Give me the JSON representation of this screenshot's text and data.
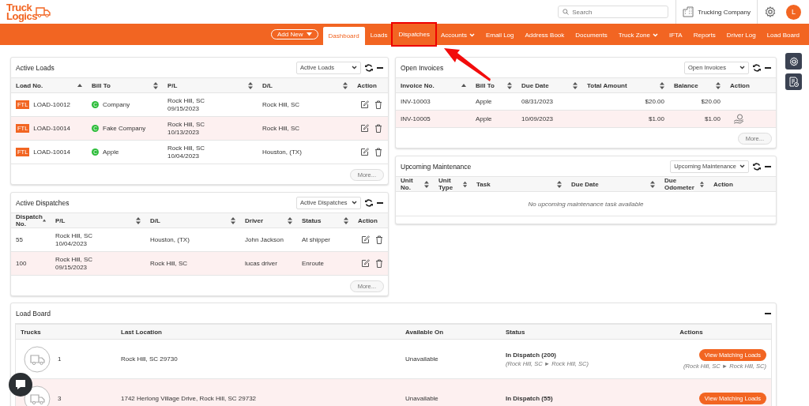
{
  "header": {
    "logo": {
      "line1": "Truck",
      "line2": "Logics"
    },
    "search": {
      "placeholder": "Search"
    },
    "company": "Trucking Company",
    "avatar": "L"
  },
  "nav": {
    "add_new": "Add New",
    "items": [
      {
        "label": "Dashboard",
        "selected": true,
        "dropdown": false,
        "highlighted": false
      },
      {
        "label": "Loads",
        "selected": false,
        "dropdown": false,
        "highlighted": false
      },
      {
        "label": "Dispatches",
        "selected": false,
        "dropdown": false,
        "highlighted": true
      },
      {
        "label": "Accounts",
        "selected": false,
        "dropdown": true,
        "highlighted": false
      },
      {
        "label": "Email Log",
        "selected": false,
        "dropdown": false,
        "highlighted": false
      },
      {
        "label": "Address Book",
        "selected": false,
        "dropdown": false,
        "highlighted": false
      },
      {
        "label": "Documents",
        "selected": false,
        "dropdown": false,
        "highlighted": false
      },
      {
        "label": "Truck Zone",
        "selected": false,
        "dropdown": true,
        "highlighted": false
      },
      {
        "label": "IFTA",
        "selected": false,
        "dropdown": false,
        "highlighted": false
      },
      {
        "label": "Reports",
        "selected": false,
        "dropdown": false,
        "highlighted": false
      },
      {
        "label": "Driver Log",
        "selected": false,
        "dropdown": false,
        "highlighted": false
      },
      {
        "label": "Load Board",
        "selected": false,
        "dropdown": false,
        "highlighted": false
      }
    ]
  },
  "active_loads": {
    "title": "Active Loads",
    "select": "Active Loads",
    "more": "More...",
    "columns": [
      {
        "label": "Load No.",
        "sortable": true,
        "sorted": true
      },
      {
        "label": "Bill To",
        "sortable": true,
        "sorted": false
      },
      {
        "label": "P/L",
        "sortable": true,
        "sorted": false
      },
      {
        "label": "D/L",
        "sortable": true,
        "sorted": false
      },
      {
        "label": "Action",
        "sortable": false
      }
    ],
    "rows": [
      {
        "tag": "FTL",
        "load_no": "LOAD-10012",
        "badge": "C",
        "bill_to": "Company",
        "pl": [
          "Rock Hill, SC",
          "09/15/2023"
        ],
        "dl": "Rock Hill, SC",
        "editable": true,
        "deletable": true
      },
      {
        "tag": "FTL",
        "load_no": "LOAD-10014",
        "badge": "C",
        "bill_to": "Fake Company",
        "pl": [
          "Rock Hill, SC",
          "10/13/2023"
        ],
        "dl": "Rock Hill, SC",
        "editable": true,
        "deletable": true
      },
      {
        "tag": "FTL",
        "load_no": "LOAD-10014",
        "badge": "C",
        "bill_to": "Apple",
        "pl": [
          "Rock Hill, SC",
          "10/04/2023"
        ],
        "dl": "Houston, (TX)",
        "editable": true,
        "deletable": true
      }
    ]
  },
  "active_dispatches": {
    "title": "Active Dispatches",
    "select": "Active Dispatches",
    "more": "More...",
    "columns": [
      {
        "label": "Dispatch No.",
        "sortable": true,
        "sorted": true
      },
      {
        "label": "P/L",
        "sortable": true,
        "sorted": false
      },
      {
        "label": "D/L",
        "sortable": true,
        "sorted": false
      },
      {
        "label": "Driver",
        "sortable": true,
        "sorted": false
      },
      {
        "label": "Status",
        "sortable": true,
        "sorted": false
      },
      {
        "label": "Action",
        "sortable": false
      }
    ],
    "rows": [
      {
        "cells": [
          "55",
          [
            "Rock Hill, SC",
            "10/04/2023"
          ],
          "Houston, (TX)",
          "John Jackson",
          "At shipper"
        ],
        "editable": true,
        "deletable": true
      },
      {
        "cells": [
          "100",
          [
            "Rock Hill, SC",
            "09/15/2023"
          ],
          "Rock Hill, SC",
          "lucas driver",
          "Enroute"
        ],
        "editable": true,
        "deletable": true
      }
    ]
  },
  "open_invoices": {
    "title": "Open Invoices",
    "select": "Open Invoices",
    "more": "More...",
    "columns": [
      {
        "label": "Invoice No.",
        "sortable": true,
        "sorted": true
      },
      {
        "label": "Bill To",
        "sortable": true,
        "sorted": false
      },
      {
        "label": "Due Date",
        "sortable": true,
        "sorted": false
      },
      {
        "label": "Total Amount",
        "sortable": true,
        "sorted": false
      },
      {
        "label": "Balance",
        "sortable": true,
        "sorted": false
      },
      {
        "label": "Action",
        "sortable": false
      }
    ],
    "rows": [
      {
        "cells": [
          "INV-10003",
          "Apple",
          "08/31/2023",
          "$20.00",
          "$20.00"
        ],
        "payable": false
      },
      {
        "cells": [
          "INV-10005",
          "Apple",
          "10/09/2023",
          "$1.00",
          "$1.00"
        ],
        "payable": true
      }
    ]
  },
  "upcoming_maintenance": {
    "title": "Upcoming Maintenance",
    "select": "Upcoming Maintenance",
    "columns": [
      {
        "label": "Unit No.",
        "sortable": true,
        "sorted": false
      },
      {
        "label": "Unit Type",
        "sortable": true,
        "sorted": false
      },
      {
        "label": "Task",
        "sortable": true,
        "sorted": false
      },
      {
        "label": "Due Date",
        "sortable": true,
        "sorted": false
      },
      {
        "label": "Due Odometer",
        "sortable": true,
        "sorted": false
      },
      {
        "label": "Action",
        "sortable": false
      }
    ],
    "empty": "No upcoming maintenance task available"
  },
  "load_board": {
    "title": "Load Board",
    "columns": [
      "Trucks",
      "Last Location",
      "Available On",
      "Status",
      "Actions"
    ],
    "rows": [
      {
        "truck": "1",
        "location": "Rock Hill, SC 29730",
        "available": "Unavailable",
        "status": "In Dispatch (200)",
        "route": "(Rock Hill, SC ► Rock Hill, SC)",
        "button": "View Matching Loads",
        "action_route": "(Rock Hill, SC ► Rock Hill, SC)"
      },
      {
        "truck": "3",
        "location": "1742 Herlong Village Drive, Rock Hill, SC 29732",
        "available": "Unavailable",
        "status": "In Dispatch (55)",
        "button": "View Matching Loads"
      }
    ]
  }
}
